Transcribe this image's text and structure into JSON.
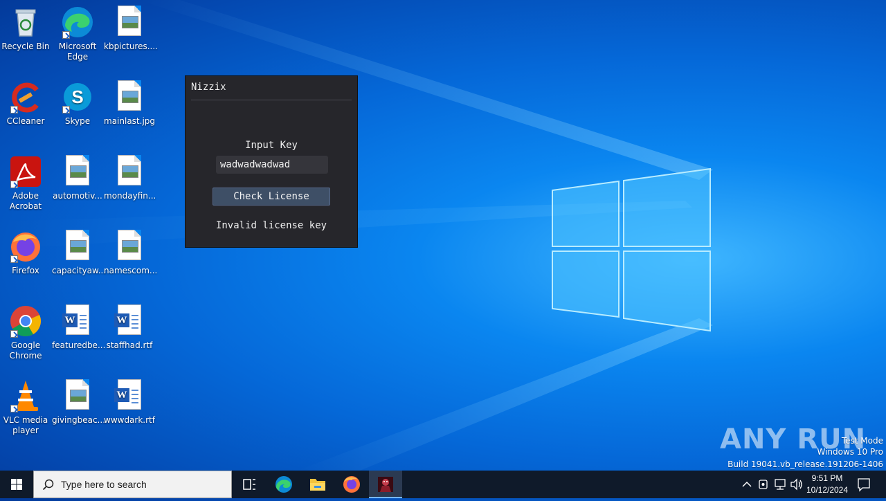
{
  "desktop": {
    "icons": [
      {
        "label": "Recycle Bin",
        "icon": "recycle-bin-icon"
      },
      {
        "label": "Microsoft Edge",
        "icon": "edge-icon"
      },
      {
        "label": "kbpictures....",
        "icon": "image-file-icon"
      },
      {
        "label": "CCleaner",
        "icon": "ccleaner-icon"
      },
      {
        "label": "Skype",
        "icon": "skype-icon"
      },
      {
        "label": "mainlast.jpg",
        "icon": "image-file-icon"
      },
      {
        "label": "Adobe Acrobat",
        "icon": "acrobat-icon"
      },
      {
        "label": "automotiv...",
        "icon": "image-file-icon"
      },
      {
        "label": "mondayfin...",
        "icon": "image-file-icon"
      },
      {
        "label": "Firefox",
        "icon": "firefox-icon"
      },
      {
        "label": "capacityaw...",
        "icon": "image-file-icon"
      },
      {
        "label": "namescom...",
        "icon": "image-file-icon"
      },
      {
        "label": "Google Chrome",
        "icon": "chrome-icon"
      },
      {
        "label": "featuredbe...",
        "icon": "word-file-icon"
      },
      {
        "label": "staffhad.rtf",
        "icon": "word-file-icon"
      },
      {
        "label": "VLC media player",
        "icon": "vlc-icon"
      },
      {
        "label": "givingbeac...",
        "icon": "image-file-icon"
      },
      {
        "label": "wwwdark.rtf",
        "icon": "word-file-icon"
      }
    ]
  },
  "app": {
    "title": "Nizzix",
    "input_label": "Input Key",
    "input_value": "wadwadwadwad",
    "button_label": "Check License",
    "status": "Invalid license key"
  },
  "watermark": {
    "logo": "ANY RUN",
    "mode": "Test Mode",
    "edition": "Windows 10 Pro",
    "build": "Build 19041.vb_release.191206-1406"
  },
  "taskbar": {
    "search_placeholder": "Type here to search",
    "time": "9:51 PM",
    "date": "10/12/2024"
  },
  "colors": {
    "accent": "#0a86f0",
    "app_bg": "#26262b",
    "button_bg": "#3e4f66",
    "taskbar_bg": "#0f1a2a"
  }
}
